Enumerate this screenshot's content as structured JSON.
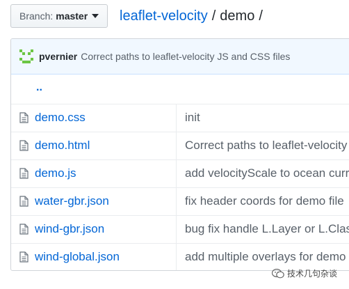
{
  "branch": {
    "label": "Branch:",
    "value": "master"
  },
  "breadcrumb": {
    "repo": "leaflet-velocity",
    "sep1": "/",
    "folder": "demo",
    "sep2": "/"
  },
  "commit": {
    "author": "pvernier",
    "message": "Correct paths to leaflet-velocity JS and CSS files"
  },
  "up_dir": "..",
  "files": [
    {
      "name": "demo.css",
      "message": "init"
    },
    {
      "name": "demo.html",
      "message": "Correct paths to leaflet-velocity"
    },
    {
      "name": "demo.js",
      "message": "add velocityScale to ocean curr"
    },
    {
      "name": "water-gbr.json",
      "message": "fix header coords for demo file"
    },
    {
      "name": "wind-gbr.json",
      "message": "bug fix handle L.Layer or L.Clas"
    },
    {
      "name": "wind-global.json",
      "message": "add multiple overlays for demo"
    }
  ],
  "watermark": "技术几句杂谈",
  "colors": {
    "link": "#0366d6",
    "muted": "#586069",
    "commit_bg": "#f1f8ff",
    "avatar": "#6cc644"
  }
}
